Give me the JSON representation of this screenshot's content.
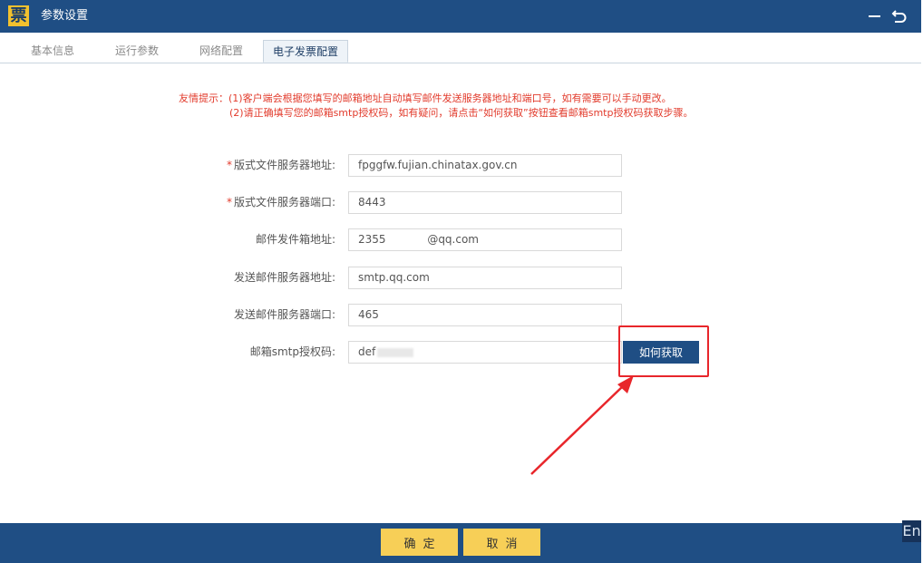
{
  "window": {
    "logo_char": "票",
    "title": "参数设置",
    "minimize_icon": "minimize-icon",
    "back_icon": "return-icon"
  },
  "tabs": [
    {
      "label": "基本信息",
      "active": false
    },
    {
      "label": "运行参数",
      "active": false
    },
    {
      "label": "网络配置",
      "active": false
    },
    {
      "label": "电子发票配置",
      "active": true
    }
  ],
  "tips": {
    "line1": "友情提示：(1)客户端会根据您填写的邮箱地址自动填写邮件发送服务器地址和端口号，如有需要可以手动更改。",
    "line2": "(2)请正确填写您的邮箱smtp授权码，如有疑问，请点击“如何获取”按钮查看邮箱smtp授权码获取步骤。"
  },
  "form": {
    "fields": [
      {
        "label": "版式文件服务器地址:",
        "required": true,
        "value": "fpggfw.fujian.chinatax.gov.cn"
      },
      {
        "label": "版式文件服务器端口:",
        "required": true,
        "value": "8443"
      },
      {
        "label": "邮件发件箱地址:",
        "required": false,
        "value": "2355            @qq.com"
      },
      {
        "label": "发送邮件服务器地址:",
        "required": false,
        "value": "smtp.qq.com"
      },
      {
        "label": "发送邮件服务器端口:",
        "required": false,
        "value": "465"
      },
      {
        "label": "邮箱smtp授权码:",
        "required": false,
        "value": "def"
      }
    ],
    "required_mark": "*",
    "how_button": "如何获取"
  },
  "footer": {
    "ok_label": "确定",
    "cancel_label": "取消",
    "corner_text": "En"
  },
  "colors": {
    "brand": "#1f4e84",
    "accent_button": "#f7cf57",
    "tip_red": "#e23b2c",
    "annotation_red": "#e8262b"
  }
}
